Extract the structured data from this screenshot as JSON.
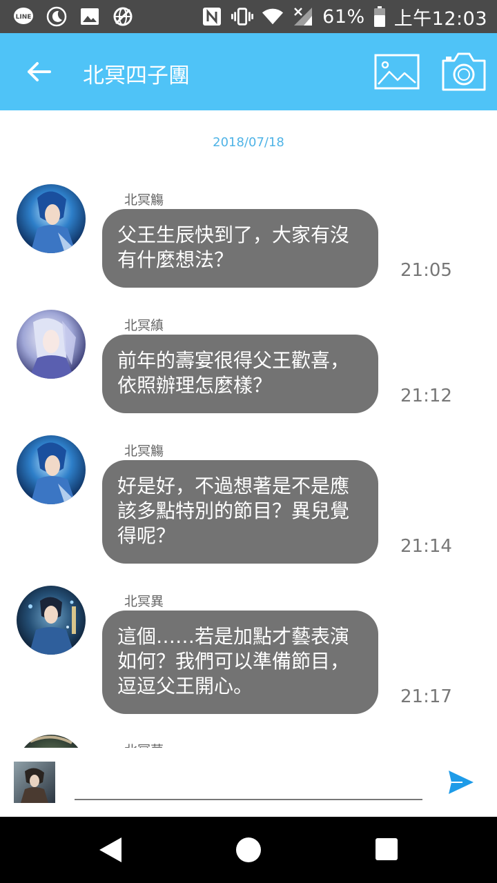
{
  "status_bar": {
    "icons_left": [
      "line-icon",
      "moon-icon",
      "image-icon",
      "blocked-globe-icon"
    ],
    "icons_right": [
      "nfc-icon",
      "vibrate-icon",
      "wifi-icon",
      "signal-icon",
      "battery-icon"
    ],
    "battery": "61%",
    "time": "上午12:03"
  },
  "app_bar": {
    "title": "北冥四子團",
    "accent_color": "#4fc3f7"
  },
  "chat": {
    "date": "2018/07/18",
    "messages": [
      {
        "sender": "北冥觴",
        "text": "父王生辰快到了，大家有沒有什麼想法？",
        "time": "21:05"
      },
      {
        "sender": "北冥縝",
        "text": "前年的壽宴很得父王歡喜，依照辦理怎麼樣？",
        "time": "21:12"
      },
      {
        "sender": "北冥觴",
        "text": "好是好，不過想著是不是應該多點特別的節目？異兒覺得呢？",
        "time": "21:14"
      },
      {
        "sender": "北冥異",
        "text": "這個……若是加點才藝表演如何？我們可以準備節目，逗逗父王開心。",
        "time": "21:17"
      },
      {
        "sender": "北冥華"
      }
    ]
  },
  "input": {
    "value": "",
    "placeholder": ""
  },
  "nav_bar": {
    "buttons": [
      "back-icon",
      "home-icon",
      "recents-icon"
    ]
  }
}
